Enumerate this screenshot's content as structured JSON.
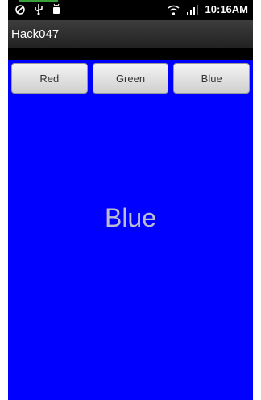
{
  "status_bar": {
    "time": "10:16AM",
    "icons_left": [
      "sync-icon",
      "usb-icon",
      "android-debug-icon"
    ],
    "icons_right": [
      "wifi-icon",
      "signal-icon"
    ]
  },
  "app": {
    "title": "Hack047"
  },
  "buttons": [
    {
      "label": "Red"
    },
    {
      "label": "Green"
    },
    {
      "label": "Blue"
    }
  ],
  "display": {
    "label": "Blue",
    "background_color": "#0000ff"
  }
}
